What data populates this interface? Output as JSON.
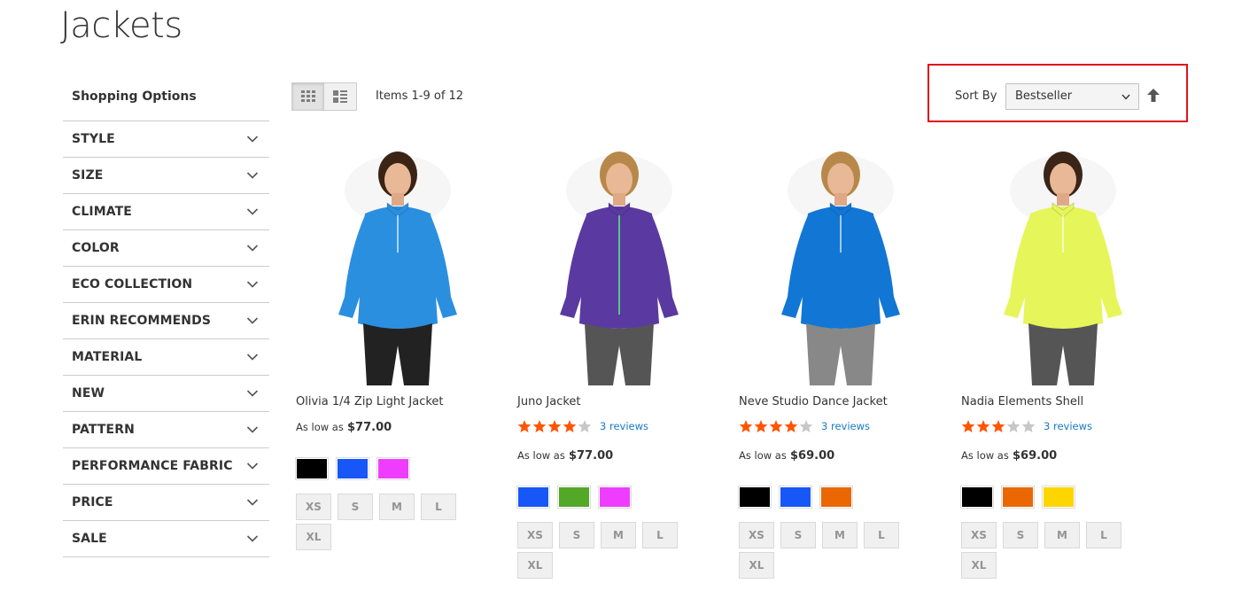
{
  "page": {
    "title": "Jackets"
  },
  "sidebar": {
    "title": "Shopping Options",
    "filters": [
      "STYLE",
      "SIZE",
      "CLIMATE",
      "COLOR",
      "ECO COLLECTION",
      "ERIN RECOMMENDS",
      "MATERIAL",
      "NEW",
      "PATTERN",
      "PERFORMANCE FABRIC",
      "PRICE",
      "SALE"
    ]
  },
  "toolbar": {
    "amount": "Items 1-9 of 12",
    "sort_label": "Sort By",
    "sort_value": "Bestseller",
    "view_modes": [
      "grid-icon",
      "list-icon"
    ]
  },
  "products": [
    {
      "name": "Olivia 1/4 Zip Light Jacket",
      "rating": null,
      "reviews": null,
      "price_label": "As low as",
      "price": "$77.00",
      "colors": [
        "#000000",
        "#1857f7",
        "#ef3dff"
      ],
      "sizes": [
        "XS",
        "S",
        "M",
        "L",
        "XL"
      ],
      "shirt_color": "#2b8fe0",
      "pants_color": "#222222"
    },
    {
      "name": "Juno Jacket",
      "rating": 4,
      "reviews": "3 reviews",
      "price_label": "As low as",
      "price": "$77.00",
      "colors": [
        "#1857f7",
        "#53a828",
        "#ef3dff"
      ],
      "sizes": [
        "XS",
        "S",
        "M",
        "L",
        "XL"
      ],
      "shirt_color": "#5a3aa0",
      "pants_color": "#555555"
    },
    {
      "name": "Neve Studio Dance Jacket",
      "rating": 4,
      "reviews": "3 reviews",
      "price_label": "As low as",
      "price": "$69.00",
      "colors": [
        "#000000",
        "#1857f7",
        "#eb6703"
      ],
      "sizes": [
        "XS",
        "S",
        "M",
        "L",
        "XL"
      ],
      "shirt_color": "#1276d4",
      "pants_color": "#888888"
    },
    {
      "name": "Nadia Elements Shell",
      "rating": 3,
      "reviews": "3 reviews",
      "price_label": "As low as",
      "price": "$69.00",
      "colors": [
        "#000000",
        "#eb6703",
        "#ffd500"
      ],
      "sizes": [
        "XS",
        "S",
        "M",
        "L",
        "XL"
      ],
      "shirt_color": "#e6f55a",
      "pants_color": "#555555"
    }
  ],
  "colors": {
    "accent_link": "#1979c3",
    "star_filled": "#ff5501",
    "star_empty": "#c7c7c7",
    "highlight": "#e0121a"
  }
}
